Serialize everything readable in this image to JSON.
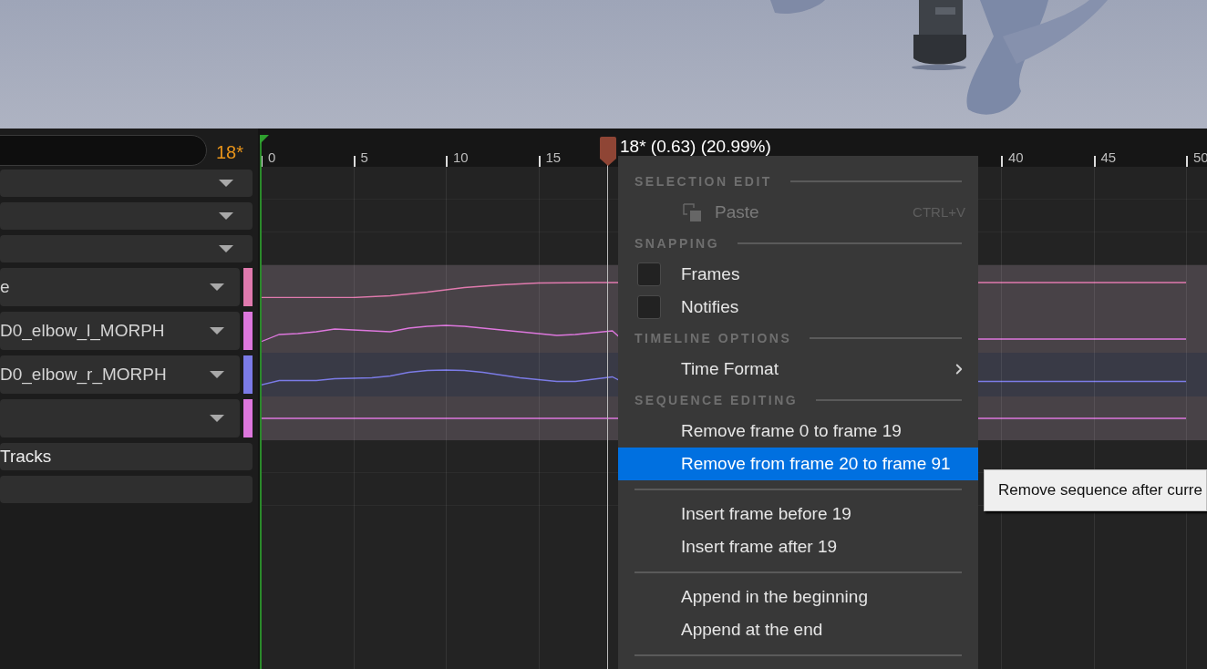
{
  "track_search": {
    "frame": "18*"
  },
  "tracks": [
    {
      "kind": "header"
    },
    {
      "kind": "header"
    },
    {
      "kind": "header"
    },
    {
      "kind": "curve",
      "label": "e",
      "color": "#e07aae"
    },
    {
      "kind": "curve",
      "label": "D0_elbow_l_MORPH",
      "color": "#dd77dd"
    },
    {
      "kind": "curve",
      "label": "D0_elbow_r_MORPH",
      "color": "#7b7be6"
    },
    {
      "kind": "curve",
      "color": "#dd77dd"
    },
    {
      "kind": "group",
      "label": "Tracks"
    },
    {
      "kind": "group"
    }
  ],
  "ruler": {
    "ticks": [
      "0",
      "5",
      "10",
      "15",
      "40",
      "45",
      "50"
    ]
  },
  "scrubber": {
    "label": "18* (0.63) (20.99%)"
  },
  "context_menu": {
    "sections": [
      {
        "heading": "SELECTION EDIT",
        "items": [
          {
            "kind": "command",
            "label": "Paste",
            "shortcut": "CTRL+V",
            "disabled": true,
            "selected": false
          }
        ]
      },
      {
        "heading": "SNAPPING",
        "items": [
          {
            "kind": "checkbox",
            "label": "Frames",
            "checked": false
          },
          {
            "kind": "checkbox",
            "label": "Notifies",
            "checked": false
          }
        ]
      },
      {
        "heading": "TIMELINE OPTIONS",
        "items": [
          {
            "kind": "submenu",
            "label": "Time Format",
            "disabled": false,
            "selected": false
          }
        ]
      },
      {
        "heading": "SEQUENCE EDITING",
        "items": [
          {
            "kind": "command",
            "label": "Remove frame 0 to frame 19",
            "disabled": false,
            "selected": false
          },
          {
            "kind": "command",
            "label": "Remove from frame 20 to frame 91",
            "disabled": false,
            "selected": true
          }
        ]
      },
      {
        "items": [
          {
            "kind": "command",
            "label": "Insert frame before 19",
            "disabled": false,
            "selected": false
          },
          {
            "kind": "command",
            "label": "Insert frame after 19",
            "disabled": false,
            "selected": false
          }
        ]
      },
      {
        "items": [
          {
            "kind": "command",
            "label": "Append in the beginning",
            "disabled": false,
            "selected": false
          },
          {
            "kind": "command",
            "label": "Append at the end",
            "disabled": false,
            "selected": false
          }
        ]
      }
    ]
  },
  "tooltip": {
    "text": "Remove sequence after curre"
  }
}
